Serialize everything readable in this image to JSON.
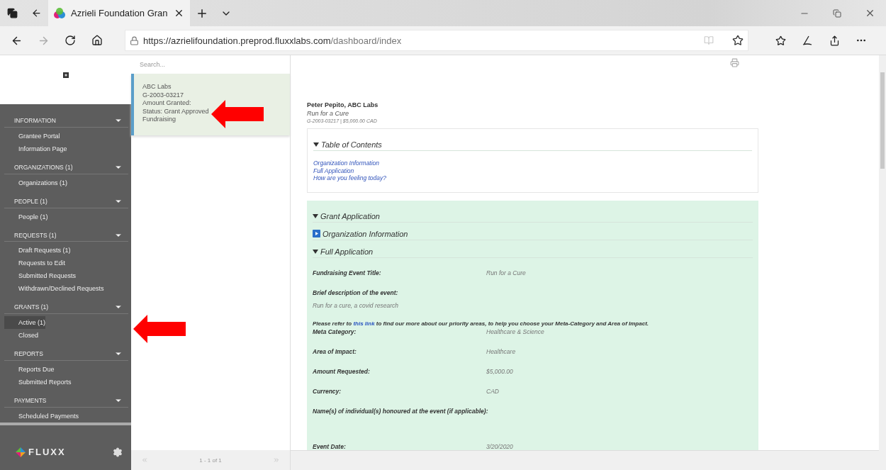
{
  "browser": {
    "tab_title": "Azrieli Foundation Gran",
    "url_host": "https://azrielifoundation.preprod.fluxxlabs.com",
    "url_path": "/dashboard/index"
  },
  "sidebar": {
    "groups": [
      {
        "title": "INFORMATION",
        "expanded": true,
        "items": [
          {
            "label": "Grantee Portal",
            "selected": false
          },
          {
            "label": "Information Page",
            "selected": false
          }
        ]
      },
      {
        "title": "ORGANIZATIONS (1)",
        "expanded": true,
        "items": [
          {
            "label": "Organizations  (1)",
            "selected": false
          }
        ]
      },
      {
        "title": "PEOPLE (1)",
        "expanded": true,
        "items": [
          {
            "label": "People  (1)",
            "selected": false
          }
        ]
      },
      {
        "title": "REQUESTS (1)",
        "expanded": true,
        "items": [
          {
            "label": "Draft Requests  (1)",
            "selected": false
          },
          {
            "label": "Requests to Edit",
            "selected": false
          },
          {
            "label": "Submitted Requests",
            "selected": false
          },
          {
            "label": "Withdrawn/Declined Requests",
            "selected": false
          }
        ]
      },
      {
        "title": "GRANTS (1)",
        "expanded": true,
        "items": [
          {
            "label": "Active  (1)",
            "selected": true
          },
          {
            "label": "Closed",
            "selected": false
          }
        ]
      },
      {
        "title": "REPORTS",
        "expanded": true,
        "items": [
          {
            "label": "Reports Due",
            "selected": false
          },
          {
            "label": "Submitted Reports",
            "selected": false
          }
        ]
      },
      {
        "title": "PAYMENTS",
        "expanded": true,
        "items": [
          {
            "label": "Scheduled Payments",
            "selected": false
          }
        ]
      }
    ],
    "brand": "FLUXX"
  },
  "list": {
    "search_placeholder": "Search...",
    "cards": [
      {
        "lines": [
          "ABC Labs",
          "G-2003-03217",
          "Amount Granted:",
          "Status: Grant Approved",
          "Fundraising"
        ],
        "selected": true
      }
    ],
    "pager": "1 - 1 of 1"
  },
  "detail": {
    "name": "Peter Pepito, ABC Labs",
    "subtitle": "Run for a Cure",
    "meta": "G-2003-03217 | $5,000.00 CAD",
    "toc": {
      "title": "Table of Contents",
      "links": [
        "Organization Information",
        "Full Application",
        "How are you feeling today?"
      ]
    },
    "sections": [
      {
        "title": "Grant Application",
        "expanded": true
      },
      {
        "title": "Organization Information",
        "expanded": false
      },
      {
        "title": "Full Application",
        "expanded": true
      }
    ],
    "fields": [
      {
        "kind": "pair",
        "label": "Fundraising Event Title:",
        "value": "Run for a Cure"
      },
      {
        "kind": "stacked",
        "label": "Brief description of the event:",
        "value": "Run for a cure, a covid research"
      },
      {
        "kind": "note",
        "before": "Please refer to ",
        "link": "this link",
        "after": " to find our more about our priority areas, to help you choose your Meta-Category and Area of Impact."
      },
      {
        "kind": "pair",
        "label": "Meta Category:",
        "value": "Healthcare & Science"
      },
      {
        "kind": "pair",
        "label": "Area of Impact:",
        "value": "Healthcare"
      },
      {
        "kind": "pair",
        "label": "Amount Requested:",
        "value": "$5,000.00"
      },
      {
        "kind": "pair",
        "label": "Currency:",
        "value": "CAD"
      },
      {
        "kind": "stacked",
        "label": "Name(s) of individual(s) honoured at the event (if applicable):"
      },
      {
        "kind": "pair",
        "label": "Event Date:",
        "value": "3/20/2020"
      }
    ]
  }
}
